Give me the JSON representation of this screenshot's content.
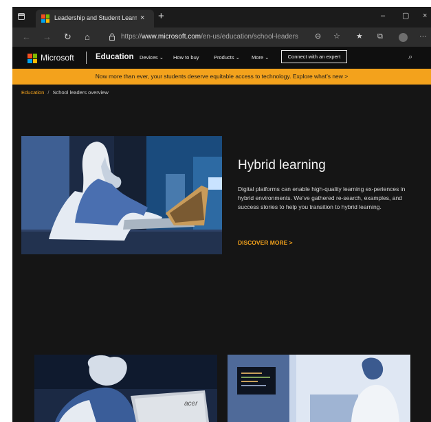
{
  "browser": {
    "tab_title": "Leadership and Student Learning",
    "tab_close": "×",
    "new_tab": "+",
    "window_controls": {
      "minimize": "–",
      "maximize": "▢",
      "close": "×"
    },
    "nav": {
      "back": "←",
      "forward": "→",
      "refresh": "↻",
      "home": "⌂"
    },
    "url_prefix": "https://",
    "url_domain": "www.microsoft.com",
    "url_path": "/en-us/education/school-leaders",
    "toolbar_icons": [
      "zoom-icon",
      "favorite-add-icon",
      "favorites-icon",
      "collections-icon",
      "profile-icon",
      "more-icon"
    ],
    "toolbar_glyphs": {
      "zoom": "⊖",
      "favorite_add": "☆",
      "favorites": "★",
      "collections": "⧉",
      "more": "···"
    }
  },
  "site_nav": {
    "brand": "Microsoft",
    "section": "Education",
    "items": [
      "Devices ⌄",
      "How to buy",
      "Products ⌄",
      "More ⌄"
    ],
    "cta": "Connect with an expert",
    "search_glyph": "⌕"
  },
  "banner": {
    "text": "Now more than ever, your students deserve equitable access to technology. Explore what’s new >"
  },
  "breadcrumb": {
    "root": "Education",
    "separator": "/",
    "current": "School leaders overview"
  },
  "hero": {
    "title": "Hybrid learning",
    "body": "Digital platforms can enable high-quality learning ex-periences in hybrid environments. We’ve gathered re-search, examples, and success stories to help you transition to hybrid learning.",
    "link": "DISCOVER MORE >"
  },
  "cards": [
    {
      "image_badge": "acer"
    },
    {
      "image_badge": ""
    }
  ],
  "colors": {
    "page_bg": "#151515",
    "accent": "#f3a21c",
    "ms_red": "#f25022",
    "ms_green": "#7fba00",
    "ms_blue": "#00a4ef",
    "ms_yellow": "#ffb900"
  }
}
